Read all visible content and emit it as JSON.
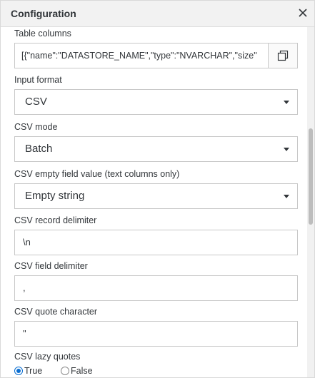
{
  "header": {
    "title": "Configuration"
  },
  "fields": {
    "table_columns": {
      "label": "Table columns",
      "value": "[{\"name\":\"DATASTORE_NAME\",\"type\":\"NVARCHAR\",\"size\""
    },
    "input_format": {
      "label": "Input format",
      "value": "CSV"
    },
    "csv_mode": {
      "label": "CSV mode",
      "value": "Batch"
    },
    "csv_empty_field": {
      "label": "CSV empty field value (text columns only)",
      "value": "Empty string"
    },
    "csv_record_delimiter": {
      "label": "CSV record delimiter",
      "value": "\\n"
    },
    "csv_field_delimiter": {
      "label": "CSV field delimiter",
      "value": ","
    },
    "csv_quote_character": {
      "label": "CSV quote character",
      "value": "\""
    },
    "csv_lazy_quotes": {
      "label": "CSV lazy quotes",
      "options": [
        "True",
        "False"
      ],
      "selected": "True"
    }
  },
  "colors": {
    "accent": "#0a6ed1",
    "border": "#c8c8c8",
    "header_bg": "#f2f2f2",
    "text": "#32363a"
  },
  "icons": {
    "close": "close-icon",
    "copy": "copy-icon",
    "dropdown": "chevron-down-icon"
  }
}
